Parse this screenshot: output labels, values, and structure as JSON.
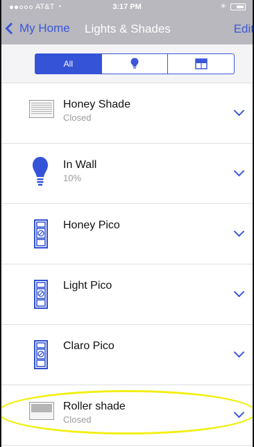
{
  "status_bar": {
    "carrier": "AT&T",
    "time": "3:17 PM"
  },
  "nav": {
    "back_label": "My Home",
    "title": "Lights & Shades",
    "edit_label": "Edit"
  },
  "segments": {
    "all_label": "All",
    "light_icon": "bulb-icon",
    "shade_icon": "window-shade-icon"
  },
  "devices": [
    {
      "name": "Honey Shade",
      "status": "Closed",
      "icon": "honeycomb-shade-icon"
    },
    {
      "name": "In Wall",
      "status": "10%",
      "icon": "bulb-icon"
    },
    {
      "name": "Honey Pico",
      "status": "",
      "icon": "pico-remote-icon"
    },
    {
      "name": "Light Pico",
      "status": "",
      "icon": "pico-remote-icon"
    },
    {
      "name": "Claro Pico",
      "status": "",
      "icon": "pico-remote-icon"
    },
    {
      "name": "Roller shade",
      "status": "Closed",
      "icon": "roller-shade-icon"
    }
  ],
  "colors": {
    "accent": "#3b56d9",
    "header": "#b8b8be",
    "highlight": "#f2ef12"
  }
}
